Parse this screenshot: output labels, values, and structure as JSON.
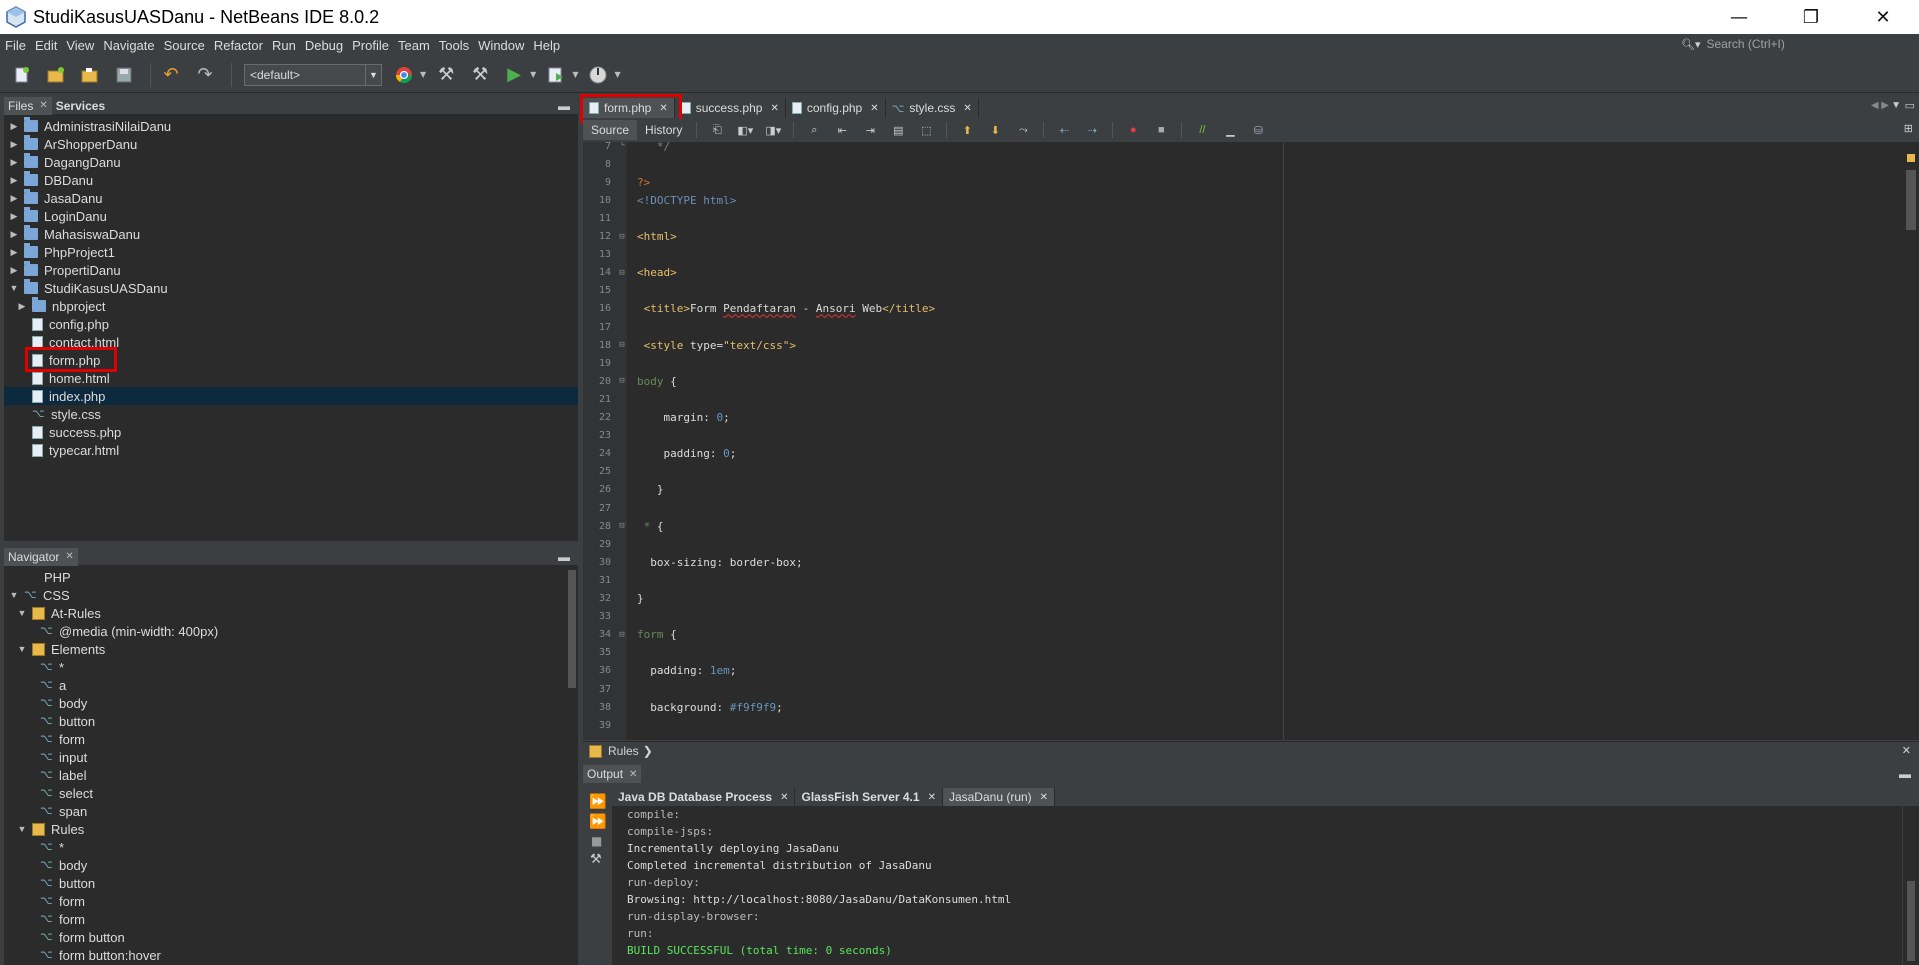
{
  "window": {
    "title": "StudiKasusUASDanu - NetBeans IDE 8.0.2",
    "controls": [
      "—",
      "❐",
      "✕"
    ]
  },
  "menu": [
    "File",
    "Edit",
    "View",
    "Navigate",
    "Source",
    "Refactor",
    "Run",
    "Debug",
    "Profile",
    "Team",
    "Tools",
    "Window",
    "Help"
  ],
  "search": {
    "placeholder": "Search (Ctrl+I)"
  },
  "toolbar": {
    "config_value": "<default>"
  },
  "files_panel": {
    "tabs": [
      "Files",
      "Services"
    ],
    "projects": [
      "AdministrasiNilaiDanu",
      "ArShopperDanu",
      "DagangDanu",
      "DBDanu",
      "JasaDanu",
      "LoginDanu",
      "MahasiswaDanu",
      "PhpProject1",
      "PropertiDanu"
    ],
    "open_project": "StudiKasusUASDanu",
    "children": [
      "nbproject",
      "config.php",
      "contact.html",
      "form.php",
      "home.html",
      "index.php",
      "style.css",
      "success.php",
      "typecar.html"
    ],
    "selected": "index.php"
  },
  "navigator": {
    "title": "Navigator",
    "items": [
      {
        "label": "PHP",
        "level": 0,
        "kind": "php"
      },
      {
        "label": "CSS",
        "level": 0,
        "kind": "css",
        "open": true
      },
      {
        "label": "At-Rules",
        "level": 1,
        "kind": "group",
        "open": true
      },
      {
        "label": "@media (min-width: 400px)",
        "level": 2,
        "kind": "css"
      },
      {
        "label": "Elements",
        "level": 1,
        "kind": "group",
        "open": true
      },
      {
        "label": "*",
        "level": 2,
        "kind": "css"
      },
      {
        "label": "a",
        "level": 2,
        "kind": "css"
      },
      {
        "label": "body",
        "level": 2,
        "kind": "css"
      },
      {
        "label": "button",
        "level": 2,
        "kind": "css"
      },
      {
        "label": "form",
        "level": 2,
        "kind": "css"
      },
      {
        "label": "input",
        "level": 2,
        "kind": "css"
      },
      {
        "label": "label",
        "level": 2,
        "kind": "css"
      },
      {
        "label": "select",
        "level": 2,
        "kind": "css"
      },
      {
        "label": "span",
        "level": 2,
        "kind": "css"
      },
      {
        "label": "Rules",
        "level": 1,
        "kind": "group",
        "open": true
      },
      {
        "label": "*",
        "level": 2,
        "kind": "css"
      },
      {
        "label": "body",
        "level": 2,
        "kind": "css"
      },
      {
        "label": "button",
        "level": 2,
        "kind": "css"
      },
      {
        "label": "form",
        "level": 2,
        "kind": "css"
      },
      {
        "label": "form",
        "level": 2,
        "kind": "css"
      },
      {
        "label": "form button",
        "level": 2,
        "kind": "css"
      },
      {
        "label": "form button:hover",
        "level": 2,
        "kind": "css"
      }
    ]
  },
  "editor": {
    "tabs": [
      "form.php",
      "success.php",
      "config.php",
      "style.css"
    ],
    "active_tab": "form.php",
    "views": [
      "Source",
      "History"
    ],
    "lines": [
      {
        "n": "7",
        "fold": "└",
        "parts": [
          {
            "t": "   */",
            "c": "c-comment"
          }
        ]
      },
      {
        "n": "8",
        "fold": "",
        "parts": []
      },
      {
        "n": "9",
        "fold": "",
        "parts": [
          {
            "t": "?>",
            "c": "c-php"
          }
        ]
      },
      {
        "n": "10",
        "fold": "",
        "parts": [
          {
            "t": "<!DOCTYPE html>",
            "c": "c-doctype"
          }
        ]
      },
      {
        "n": "11",
        "fold": "",
        "parts": []
      },
      {
        "n": "12",
        "fold": "⊟",
        "parts": [
          {
            "t": "<html>",
            "c": "c-tag"
          }
        ]
      },
      {
        "n": "13",
        "fold": "",
        "parts": []
      },
      {
        "n": "14",
        "fold": "⊟",
        "parts": [
          {
            "t": "<head>",
            "c": "c-tag"
          }
        ]
      },
      {
        "n": "15",
        "fold": "",
        "parts": []
      },
      {
        "n": "16",
        "fold": "",
        "parts": [
          {
            "t": " <title>",
            "c": "c-tag"
          },
          {
            "t": "Form ",
            "c": "c-text"
          },
          {
            "t": "Pendaftaran",
            "c": "c-text squig"
          },
          {
            "t": " - ",
            "c": "c-text"
          },
          {
            "t": "Ansori",
            "c": "c-text squig"
          },
          {
            "t": " Web",
            "c": "c-text"
          },
          {
            "t": "</title>",
            "c": "c-tag"
          }
        ]
      },
      {
        "n": "17",
        "fold": "",
        "parts": []
      },
      {
        "n": "18",
        "fold": "⊟",
        "parts": [
          {
            "t": " <style ",
            "c": "c-tag"
          },
          {
            "t": "type=",
            "c": "c-text"
          },
          {
            "t": "\"text/css\"",
            "c": "c-str"
          },
          {
            "t": ">",
            "c": "c-tag"
          }
        ]
      },
      {
        "n": "19",
        "fold": "",
        "parts": []
      },
      {
        "n": "20",
        "fold": "⊟",
        "parts": [
          {
            "t": "body",
            "c": "c-sel"
          },
          {
            "t": " {",
            "c": "c-text"
          }
        ]
      },
      {
        "n": "21",
        "fold": "",
        "parts": []
      },
      {
        "n": "22",
        "fold": "",
        "parts": [
          {
            "t": "    margin",
            "c": "c-prop"
          },
          {
            "t": ": ",
            "c": "c-text"
          },
          {
            "t": "0",
            "c": "c-val"
          },
          {
            "t": ";",
            "c": "c-text"
          }
        ]
      },
      {
        "n": "23",
        "fold": "",
        "parts": []
      },
      {
        "n": "24",
        "fold": "",
        "parts": [
          {
            "t": "    padding",
            "c": "c-prop"
          },
          {
            "t": ": ",
            "c": "c-text"
          },
          {
            "t": "0",
            "c": "c-val"
          },
          {
            "t": ";",
            "c": "c-text"
          }
        ]
      },
      {
        "n": "25",
        "fold": "",
        "parts": []
      },
      {
        "n": "26",
        "fold": "",
        "parts": [
          {
            "t": "   }",
            "c": "c-text"
          }
        ]
      },
      {
        "n": "27",
        "fold": "",
        "parts": []
      },
      {
        "n": "28",
        "fold": "⊟",
        "parts": [
          {
            "t": " * ",
            "c": "c-sel"
          },
          {
            "t": "{",
            "c": "c-text"
          }
        ]
      },
      {
        "n": "29",
        "fold": "",
        "parts": []
      },
      {
        "n": "30",
        "fold": "",
        "parts": [
          {
            "t": "  box-sizing",
            "c": "c-prop"
          },
          {
            "t": ": border-box;",
            "c": "c-text"
          }
        ]
      },
      {
        "n": "31",
        "fold": "",
        "parts": []
      },
      {
        "n": "32",
        "fold": "",
        "parts": [
          {
            "t": "}",
            "c": "c-text"
          }
        ]
      },
      {
        "n": "33",
        "fold": "",
        "parts": []
      },
      {
        "n": "34",
        "fold": "⊟",
        "parts": [
          {
            "t": "form",
            "c": "c-sel"
          },
          {
            "t": " {",
            "c": "c-text"
          }
        ]
      },
      {
        "n": "35",
        "fold": "",
        "parts": []
      },
      {
        "n": "36",
        "fold": "",
        "parts": [
          {
            "t": "  padding",
            "c": "c-prop"
          },
          {
            "t": ": ",
            "c": "c-text"
          },
          {
            "t": "1em",
            "c": "c-val"
          },
          {
            "t": ";",
            "c": "c-text"
          }
        ]
      },
      {
        "n": "37",
        "fold": "",
        "parts": []
      },
      {
        "n": "38",
        "fold": "",
        "parts": [
          {
            "t": "  background",
            "c": "c-prop"
          },
          {
            "t": ": ",
            "c": "c-text"
          },
          {
            "t": "#f9f9f9",
            "c": "c-val"
          },
          {
            "t": ";",
            "c": "c-text"
          }
        ]
      },
      {
        "n": "39",
        "fold": "",
        "parts": []
      }
    ]
  },
  "breadcrumb": {
    "label": "Rules"
  },
  "output": {
    "title": "Output",
    "tabs": [
      "Java DB Database Process",
      "GlassFish Server 4.1",
      "JasaDanu (run)"
    ],
    "lines": [
      {
        "t": "compile:",
        "k": "dim"
      },
      {
        "t": "compile-jsps:",
        "k": "dim"
      },
      {
        "t": "Incrementally deploying JasaDanu",
        "k": ""
      },
      {
        "t": "Completed incremental distribution of JasaDanu",
        "k": ""
      },
      {
        "t": "run-deploy:",
        "k": "dim"
      },
      {
        "t": "Browsing: http://localhost:8080/JasaDanu/DataKonsumen.html",
        "k": ""
      },
      {
        "t": "run-display-browser:",
        "k": "dim"
      },
      {
        "t": "run:",
        "k": "dim"
      },
      {
        "t": "BUILD SUCCESSFUL (total time: 0 seconds)",
        "k": "success"
      }
    ]
  }
}
